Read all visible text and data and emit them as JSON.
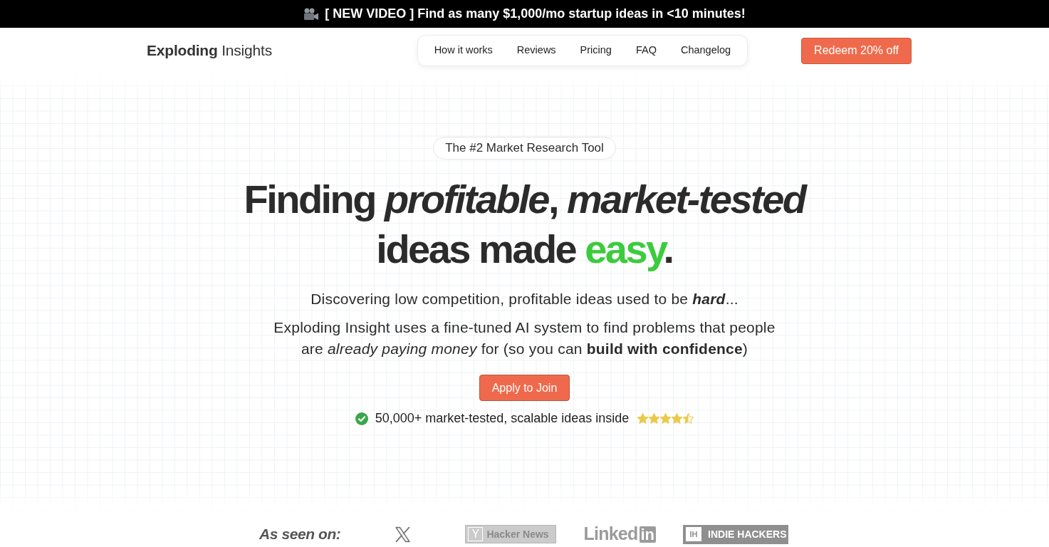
{
  "announcement_bar": {
    "text": "[ NEW VIDEO ] Find as many $1,000/mo startup ideas in <10 minutes!"
  },
  "header": {
    "logo": "**Exploding** Insights",
    "nav_items": [
      "How it works",
      "Reviews",
      "Pricing",
      "FAQ",
      "Changelog"
    ],
    "cta_button": "Redeem 20% off"
  },
  "hero": {
    "badge": "The #2 Market Research Tool",
    "headline": {
      "line_1": "Finding *profitable*, *market-tested*",
      "line_2": "ideas made",
      "highlight": "easy",
      "end": "."
    },
    "subtitle": "Discovering low competition, profitable ideas used to be **hard**...",
    "description": "Exploding Insight uses a fine-tuned AI system to find problems that people are *already paying money* for (so you can **build with confidence**)",
    "button": "Apply to Join",
    "social_proof": {
      "text": "50,000+ market-tested, scalable ideas inside",
      "stars": 4.5
    }
  },
  "as_seen_on": {
    "label": "As seen on:",
    "logos": [
      {
        "kind": "x"
      },
      {
        "kind": "hacker_news",
        "mark": "Y",
        "text": "Hacker News"
      },
      {
        "kind": "linkedin",
        "text": "Linked",
        "mark": "in"
      },
      {
        "kind": "indie_hackers",
        "mark": "IH",
        "text": "INDIE HACKERS"
      }
    ]
  }
}
